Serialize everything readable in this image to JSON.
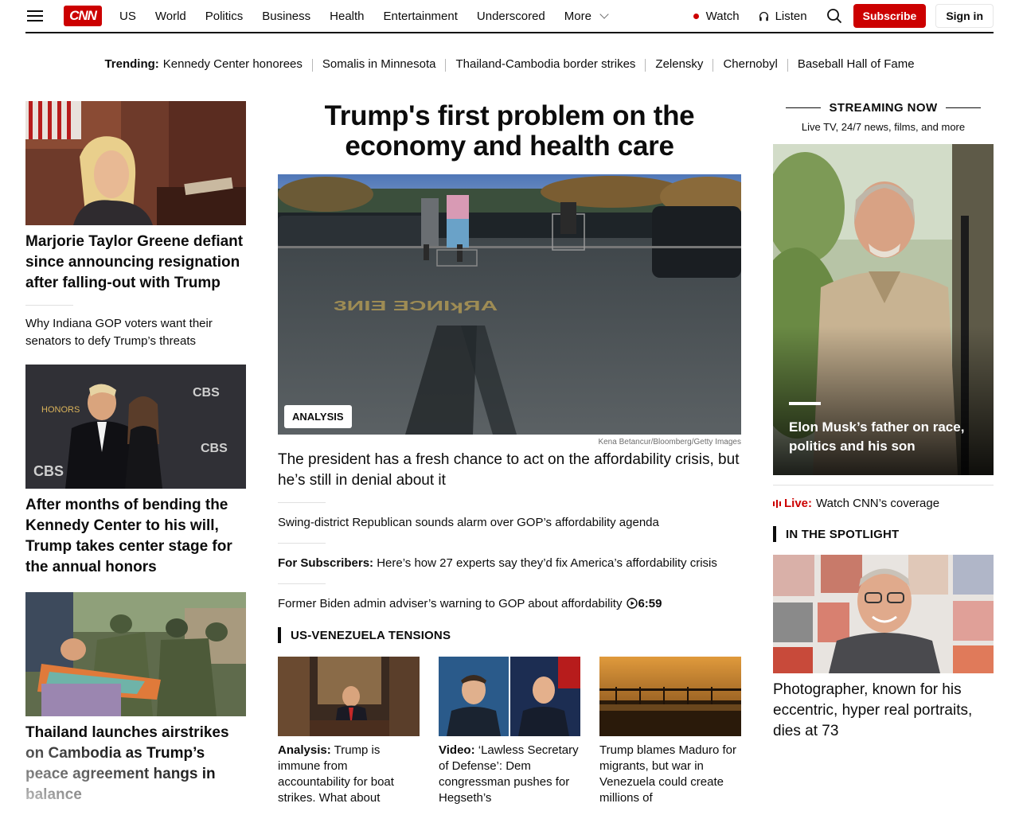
{
  "nav": {
    "logo": "CNN",
    "links": [
      "US",
      "World",
      "Politics",
      "Business",
      "Health",
      "Entertainment",
      "Underscored"
    ],
    "more": "More",
    "watch": "Watch",
    "listen": "Listen",
    "subscribe": "Subscribe",
    "sign_in": "Sign in"
  },
  "trending": {
    "label": "Trending:",
    "items": [
      "Kennedy Center honorees",
      "Somalis in Minnesota",
      "Thailand-Cambodia border strikes",
      "Zelensky",
      "Chernobyl",
      "Baseball Hall of Fame"
    ]
  },
  "left": {
    "story1": {
      "headline": "Marjorie Taylor Greene defiant since announcing resignation after falling-out with Trump",
      "related": "Why Indiana GOP voters want their senators to defy Trump’s threats"
    },
    "story2": {
      "headline": "After months of bending the Kennedy Center to his will, Trump takes center stage for the annual honors"
    },
    "story3": {
      "headline": "Thailand launches airstrikes on Cambodia as Trump’s peace agreement hangs in balance"
    }
  },
  "center": {
    "title": "Trump's first problem on the economy and health care",
    "tag": "ANALYSIS",
    "credit": "Kena Betancur/Bloomberg/Getty Images",
    "hero_headline": "The president has a fresh chance to act on the affordability crisis, but he’s still in denial about it",
    "item1": "Swing-district Republican sounds alarm over GOP’s affordability agenda",
    "item2_label": "For Subscribers:",
    "item2_text": " Here’s how 27 experts say they’d fix America’s affordability crisis",
    "item3": "Former Biden admin adviser’s warning to GOP about affordability",
    "item3_duration": "6:59",
    "section": "US-VENEZUELA TENSIONS",
    "cards": [
      {
        "label": "Analysis:",
        "text": " Trump is immune from accountability for boat strikes. What about"
      },
      {
        "label": "Video:",
        "text": " ‘Lawless Secretary of Defense’: Dem congressman pushes for Hegseth’s"
      },
      {
        "label": "",
        "text": "Trump blames Maduro for migrants, but war in Venezuela could create millions of"
      }
    ]
  },
  "right": {
    "stream_heading": "STREAMING NOW",
    "stream_sub": "Live TV, 24/7 news, films, and more",
    "stream_caption": "Elon Musk’s father on race, politics and his son",
    "live_label": "Live:",
    "live_text": "Watch CNN’s coverage",
    "spotlight": "IN THE SPOTLIGHT",
    "spot_headline": "Photographer, known for his eccentric, hyper real portraits, dies at 73"
  },
  "colors": {
    "brand_red": "#cc0000",
    "text": "#0c0c0c",
    "muted": "#6e6e6e"
  }
}
